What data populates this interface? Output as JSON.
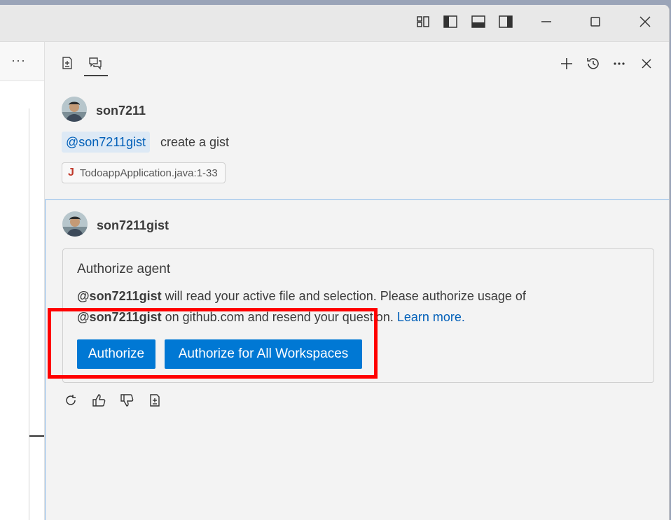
{
  "titlebar": {
    "buttons": [
      "layout-customize-icon",
      "toggle-primary-sidebar-icon",
      "toggle-panel-icon",
      "toggle-secondary-sidebar-icon",
      "minimize-icon",
      "maximize-icon",
      "close-icon"
    ]
  },
  "left": {
    "more_label": "···"
  },
  "chat": {
    "tabs": [
      {
        "icon": "new-note-icon"
      },
      {
        "icon": "chat-icon",
        "active": true
      }
    ],
    "toolbar": [
      "add-icon",
      "history-icon",
      "more-icon",
      "close-icon"
    ],
    "request": {
      "user": "son7211",
      "mention": "@son7211gist",
      "prompt": "create a gist",
      "file_reference": {
        "icon_letter": "J",
        "name": "TodoappApplication.java:1-33"
      }
    },
    "response": {
      "agent": "son7211gist",
      "auth": {
        "title": "Authorize agent",
        "agent_bold": "@son7211gist",
        "text_line1": " will read your active file and selection. Please authorize usage of",
        "agent_bold2": "@son7211gist",
        "text_line2": " on github.com and resend your question.",
        "learn_more": "Learn more.",
        "authorize_label": "Authorize",
        "authorize_all_label": "Authorize for All Workspaces"
      },
      "actions": [
        "retry-icon",
        "thumbs-up-icon",
        "thumbs-down-icon",
        "insert-icon"
      ]
    }
  },
  "colors": {
    "accent": "#0078d4",
    "highlight": "#ff0000",
    "link": "#005fb8"
  }
}
